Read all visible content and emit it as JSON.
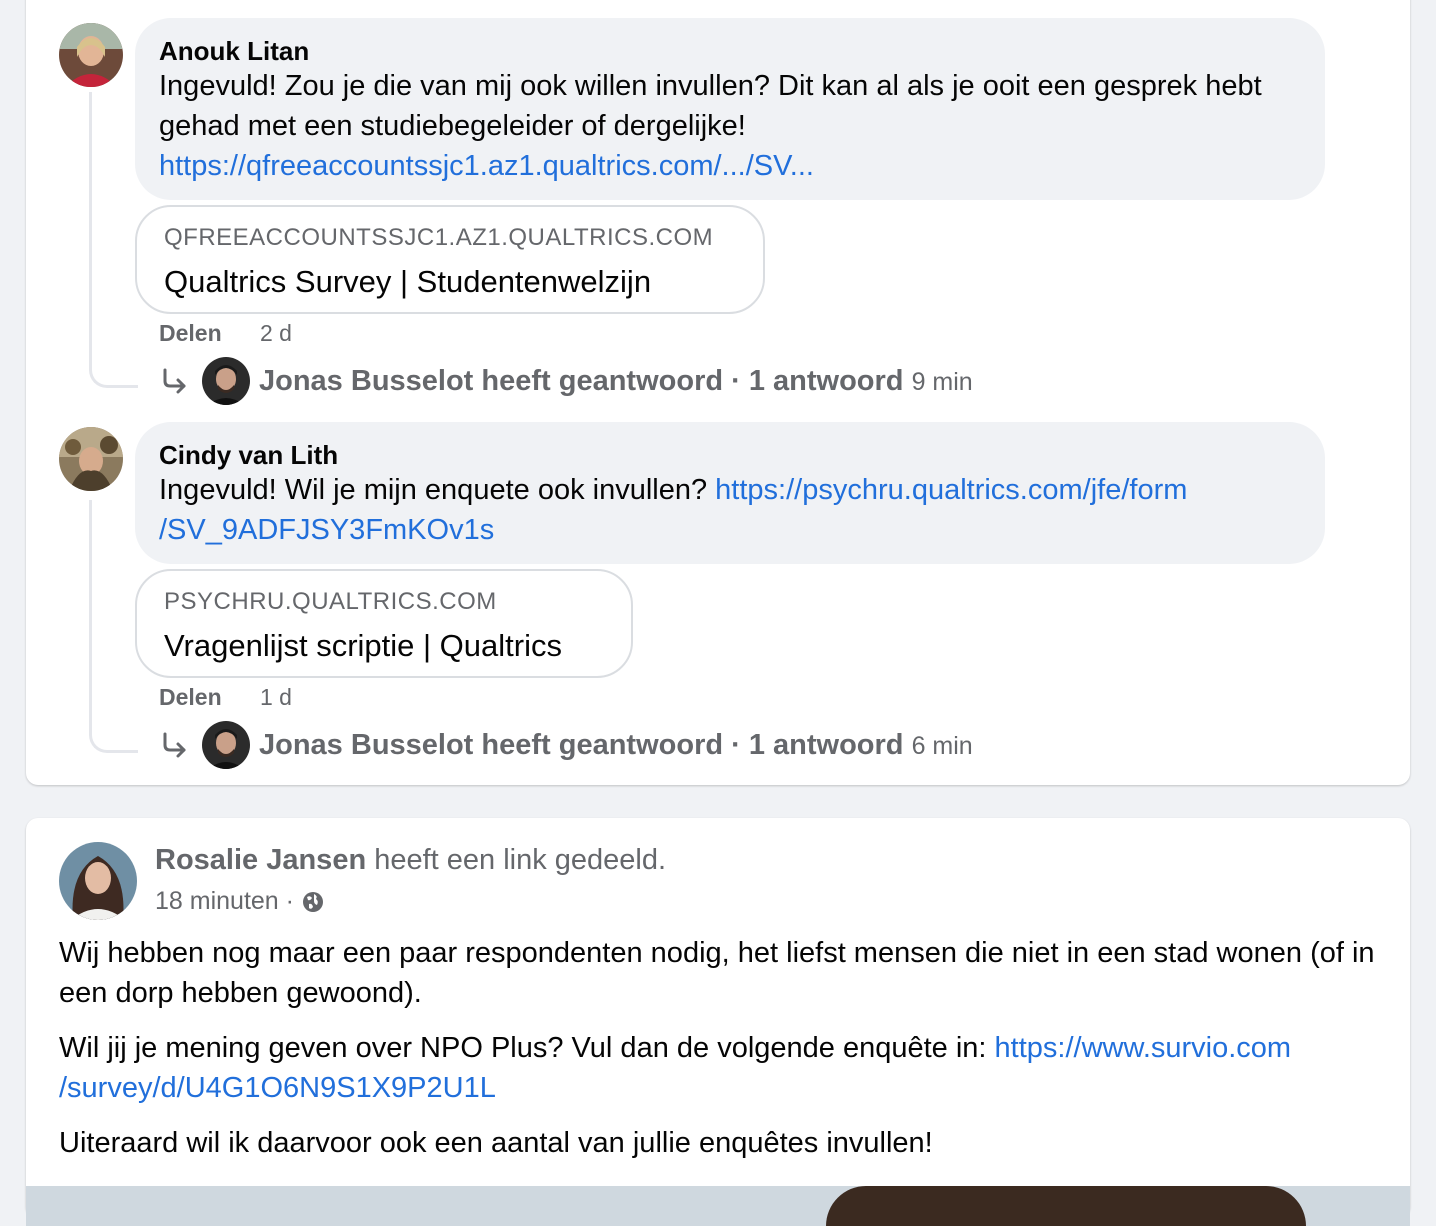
{
  "comments": [
    {
      "author": "Anouk Litan",
      "text": "Ingevuld! Zou je die van mij ook willen invullen? Dit kan al als je ooit een gesprek hebt gehad met een studiebegeleider of dergelijke!",
      "link": "https://qfreeaccountssjc1.az1.qualtrics.com/.../SV...",
      "preview_domain": "QFREEACCOUNTSSJC1.AZ1.QUALTRICS.COM",
      "preview_title": "Qualtrics Survey | Studentenwelzijn",
      "share_label": "Delen",
      "time": "2 d",
      "reply_summary": "Jonas Busselot heeft geantwoord · 1 antwoord",
      "reply_time": "9 min"
    },
    {
      "author": "Cindy van Lith",
      "text": "Ingevuld! Wil je mijn enquete ook invullen?",
      "link": "https://psychru.qualtrics.com/jfe/form/SV_9ADFJSY3FmKOv1s",
      "link_line1": "https://psychru.qualtrics.com/jfe/form",
      "link_line2": "/SV_9ADFJSY3FmKOv1s",
      "preview_domain": "PSYCHRU.QUALTRICS.COM",
      "preview_title": "Vragenlijst scriptie | Qualtrics",
      "share_label": "Delen",
      "time": "1 d",
      "reply_summary": "Jonas Busselot heeft geantwoord · 1 antwoord",
      "reply_time": "6 min"
    }
  ],
  "post": {
    "author": "Rosalie Jansen",
    "action": "heeft een link gedeeld.",
    "time": "18 minuten ·",
    "para1": "Wij hebben nog maar een paar respondenten nodig, het liefst mensen die niet in een stad wonen (of in een dorp hebben gewoond).",
    "para2_text": "Wil jij je mening geven over NPO Plus? Vul dan de volgende enquête in:",
    "para2_link1": "https://www.survio.com",
    "para2_link2": "/survey/d/U4G1O6N9S1X9P2U1L",
    "para3": "Uiteraard wil ik daarvoor ook een aantal van jullie enquêtes invullen!"
  },
  "colors": {
    "link": "#216fdb",
    "bubble": "#f0f2f5",
    "muted": "#65676b"
  },
  "icons": [
    "avatar-anouk",
    "avatar-jonas",
    "avatar-cindy",
    "avatar-rosalie",
    "reply-arrow-icon",
    "globe-icon"
  ]
}
